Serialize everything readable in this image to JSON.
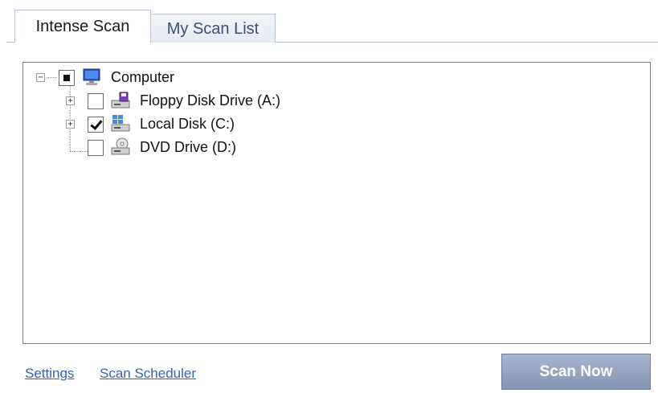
{
  "tabs": [
    {
      "label": "Intense Scan",
      "active": true
    },
    {
      "label": "My Scan List",
      "active": false
    }
  ],
  "tree": {
    "root": {
      "label": "Computer",
      "icon": "computer-icon",
      "state": "partial"
    },
    "children": [
      {
        "label": "Floppy Disk Drive (A:)",
        "icon": "floppy-drive-icon",
        "checked": false,
        "expandable": true
      },
      {
        "label": "Local Disk (C:)",
        "icon": "local-disk-icon",
        "checked": true,
        "expandable": true
      },
      {
        "label": "DVD Drive (D:)",
        "icon": "dvd-drive-icon",
        "checked": false,
        "expandable": false
      }
    ]
  },
  "footer": {
    "settings_label": "Settings",
    "scheduler_label": "Scan Scheduler",
    "scan_button_label": "Scan Now"
  },
  "colors": {
    "link": "#2f63b5",
    "button": "#8d9bb9",
    "tab_border": "#b9c3d9"
  }
}
